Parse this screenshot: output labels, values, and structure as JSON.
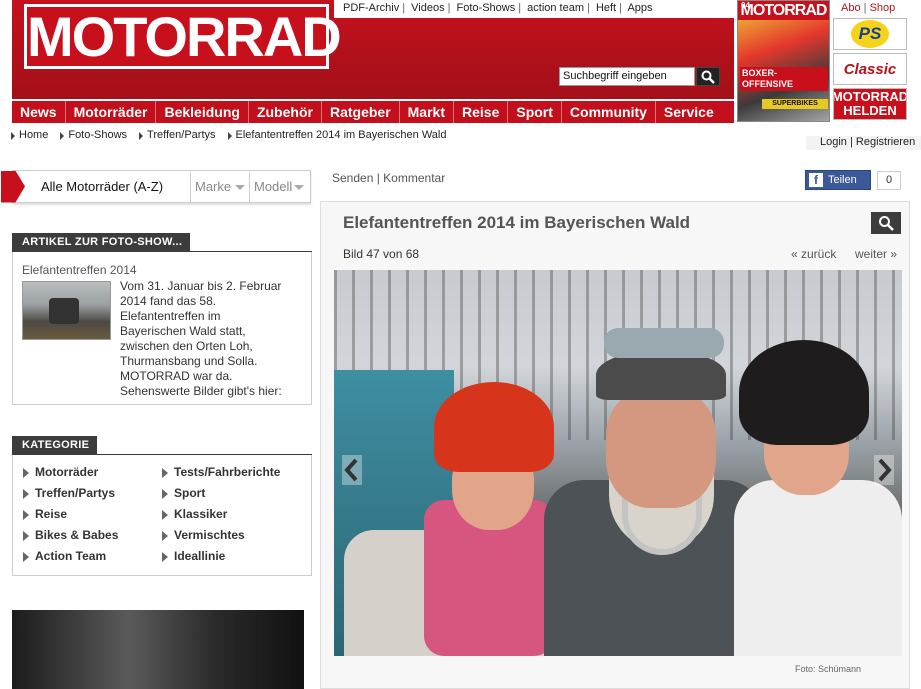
{
  "header": {
    "logo": "MOTORRAD",
    "top_links": [
      "PDF-Archiv",
      "Videos",
      "Foto-Shows",
      "action team",
      "Heft",
      "Apps"
    ],
    "abo": "Abo",
    "shop": "Shop",
    "search_placeholder": "Suchbegriff eingeben",
    "nav": [
      "News",
      "Motorräder",
      "Bekleidung",
      "Zubehör",
      "Ratgeber",
      "Markt",
      "Reise",
      "Sport",
      "Community",
      "Service"
    ],
    "magazine": {
      "issue": "04",
      "title": "MOTORRAD",
      "headline": "BOXER-OFFENSIVE",
      "sub": "SUPERBIKES"
    },
    "side_logos": [
      "PS",
      "Classic",
      "MOTORRAD HELDEN"
    ]
  },
  "breadcrumb": [
    "Home",
    "Foto-Shows",
    "Treffen/Partys",
    "Elefantentreffen 2014 im Bayerischen Wald"
  ],
  "account": {
    "login": "Login",
    "register": "Registrieren"
  },
  "model_select": {
    "all": "Alle Motorräder (A-Z)",
    "brand": "Marke",
    "model": "Modell"
  },
  "article_box": {
    "heading": "ARTIKEL ZUR FOTO-SHOW...",
    "title": "Elefantentreffen 2014",
    "lines": [
      "Vom 31. Januar bis 2. Februar",
      "2014 fand das 58.",
      "Elefantentreffen im",
      "Bayerischen Wald statt,",
      "zwischen den Orten Loh,",
      "Thurmansbang und Solla.",
      "MOTORRAD war da.",
      "Sehenswerte Bilder gibt's hier:"
    ]
  },
  "category_box": {
    "heading": "KATEGORIE",
    "col1": [
      "Motorräder",
      "Treffen/Partys",
      "Reise",
      "Bikes & Babes",
      "Action Team"
    ],
    "col2": [
      "Tests/Fahrberichte",
      "Sport",
      "Klassiker",
      "Vermischtes",
      "Ideallinie"
    ]
  },
  "share": {
    "send": "Senden",
    "comment": "Kommentar",
    "fb_label": "Teilen",
    "fb_count": "0"
  },
  "gallery": {
    "title": "Elefantentreffen 2014 im Bayerischen Wald",
    "counter": "Bild 47 von 68",
    "prev": "« zurück",
    "next": "weiter »",
    "credit": "Foto: Schümann"
  },
  "colors": {
    "brand_red": "#c8101c",
    "dark_box": "#3c3c3c",
    "facebook": "#3b5998"
  }
}
